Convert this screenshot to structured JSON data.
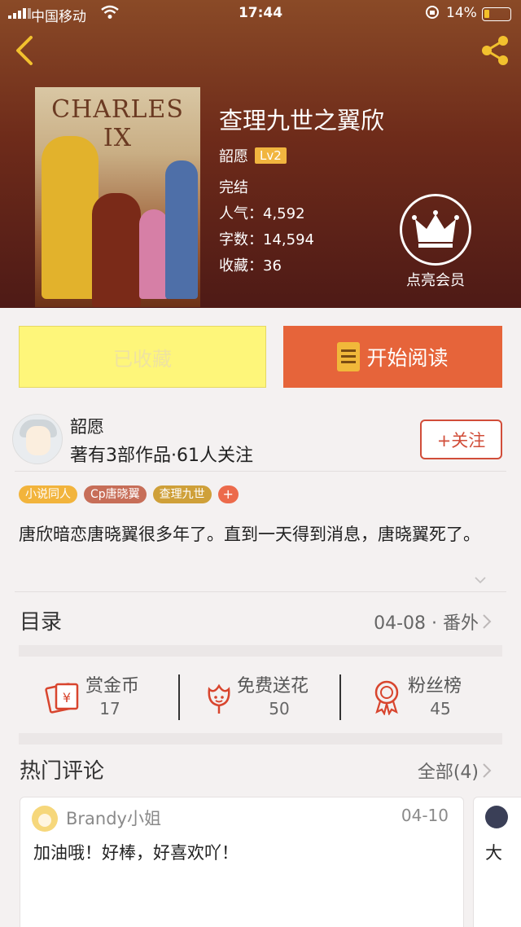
{
  "status_bar": {
    "carrier": "中国移动",
    "time": "17:44",
    "battery": "14%"
  },
  "book": {
    "cover_title": "CHARLES IX",
    "title": "查理九世之翼欣",
    "author": "韶愿",
    "level": "Lv2",
    "status": "完结",
    "popularity": "人气：4,592",
    "words": "字数：14,594",
    "collections": "收藏：36"
  },
  "vip": {
    "label": "点亮会员"
  },
  "actions": {
    "favorited_label": "已收藏",
    "read_label": "开始阅读"
  },
  "author_block": {
    "name": "韶愿",
    "stats": "著有3部作品·61人关注",
    "follow_label": "+关注"
  },
  "tags": [
    {
      "label": "小说同人",
      "color": "#f2b43c"
    },
    {
      "label": "Cp唐晓翼",
      "color": "#c76e58"
    },
    {
      "label": "查理九世",
      "color": "#cfa039"
    }
  ],
  "tag_add_label": "+",
  "summary": "唐欣暗恋唐晓翼很多年了。直到一天得到消息，唐晓翼死了。",
  "toc": {
    "label": "目录",
    "latest": "04-08 · 番外"
  },
  "stats": [
    {
      "label": "赏金币",
      "value": "17",
      "icon": "red-envelope-icon"
    },
    {
      "label": "免费送花",
      "value": "50",
      "icon": "flower-icon"
    },
    {
      "label": "粉丝榜",
      "value": "45",
      "icon": "medal-icon"
    }
  ],
  "comments_header": {
    "label": "热门评论",
    "all": "全部(4)"
  },
  "comments": [
    {
      "user": "Brandy小姐",
      "date": "04-10",
      "text": "加油哦！好棒，好喜欢吖！"
    },
    {
      "text": "大"
    }
  ],
  "colors": {
    "accent": "#e6643a",
    "favorite_bg": "#fef67a",
    "follow": "#d14d39",
    "level_badge": "#f1b53f"
  }
}
